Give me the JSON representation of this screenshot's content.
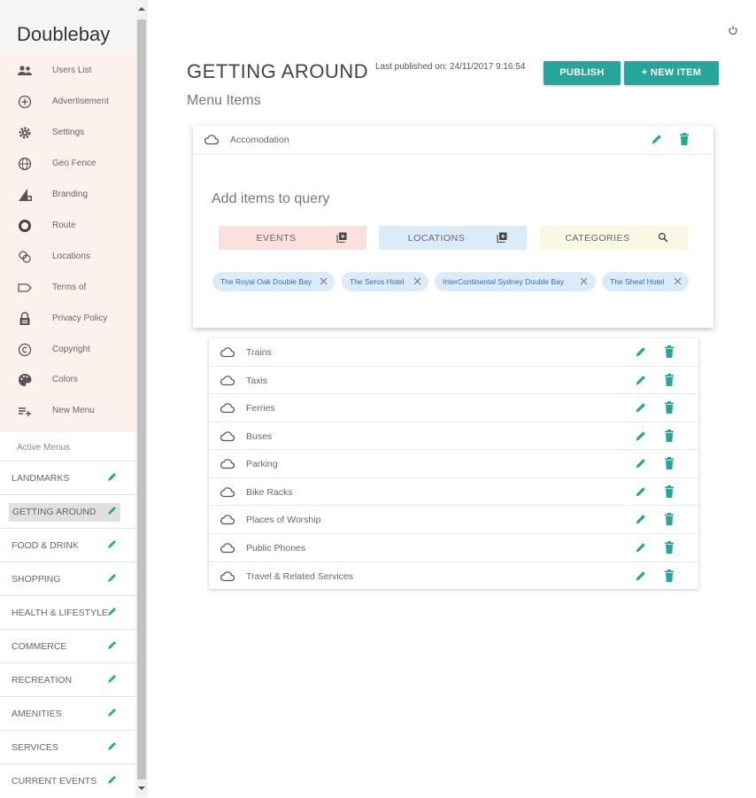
{
  "app": {
    "brand": "Doublebay"
  },
  "sidebar": {
    "items": [
      {
        "label": "Users List",
        "icon": "people-icon"
      },
      {
        "label": "Advertisement",
        "icon": "add-circle-icon"
      },
      {
        "label": "Settings",
        "icon": "gear-icon"
      },
      {
        "label": "Geo Fence",
        "icon": "globe-icon"
      },
      {
        "label": "Branding",
        "icon": "branding-icon"
      },
      {
        "label": "Route",
        "icon": "route-icon"
      },
      {
        "label": "Locations",
        "icon": "locations-icon"
      },
      {
        "label": "Terms of",
        "icon": "label-icon"
      },
      {
        "label": "Privacy Policy",
        "icon": "lock-icon"
      },
      {
        "label": "Copyright",
        "icon": "copyright-icon"
      },
      {
        "label": "Colors",
        "icon": "palette-icon"
      },
      {
        "label": "New Menu",
        "icon": "playlist-add-icon"
      }
    ],
    "active_menus_title": "Active Menus",
    "menus": [
      {
        "label": "LANDMARKS"
      },
      {
        "label": "GETTING AROUND"
      },
      {
        "label": "FOOD & DRINK"
      },
      {
        "label": "SHOPPING"
      },
      {
        "label": "HEALTH & LIFESTYLE"
      },
      {
        "label": "COMMERCE"
      },
      {
        "label": "RECREATION"
      },
      {
        "label": "AMENITIES"
      },
      {
        "label": "SERVICES"
      },
      {
        "label": "CURRENT EVENTS"
      }
    ]
  },
  "header": {
    "title": "GETTING AROUND",
    "published": "Last published on: 24/11/2017 9:16:54",
    "publish_label": "PUBLISH",
    "new_item_label": "+ NEW ITEM",
    "subtitle": "Menu Items"
  },
  "card": {
    "label": "Accomodation",
    "query_title": "Add items to query",
    "buttons": {
      "events": "EVENTS",
      "locations": "LOCATIONS",
      "categories": "CATEGORIES"
    },
    "chips": [
      "The Royal Oak Double Bay",
      "The Seros Hotel",
      "InterContinental Sydney Double Bay",
      "The Sheaf Hotel"
    ]
  },
  "list": {
    "rows": [
      "Trains",
      "Taxis",
      "Ferries",
      "Buses",
      "Parking",
      "Bike Racks",
      "Places of Worship",
      "Public Phones",
      "Travel & Related Services"
    ]
  },
  "colors": {
    "accent": "#26a69a",
    "chip_text": "#2b6fb0",
    "events_bg": "#fbe0dd",
    "locations_bg": "#dcebfa",
    "categories_bg": "#f8f8e3"
  }
}
